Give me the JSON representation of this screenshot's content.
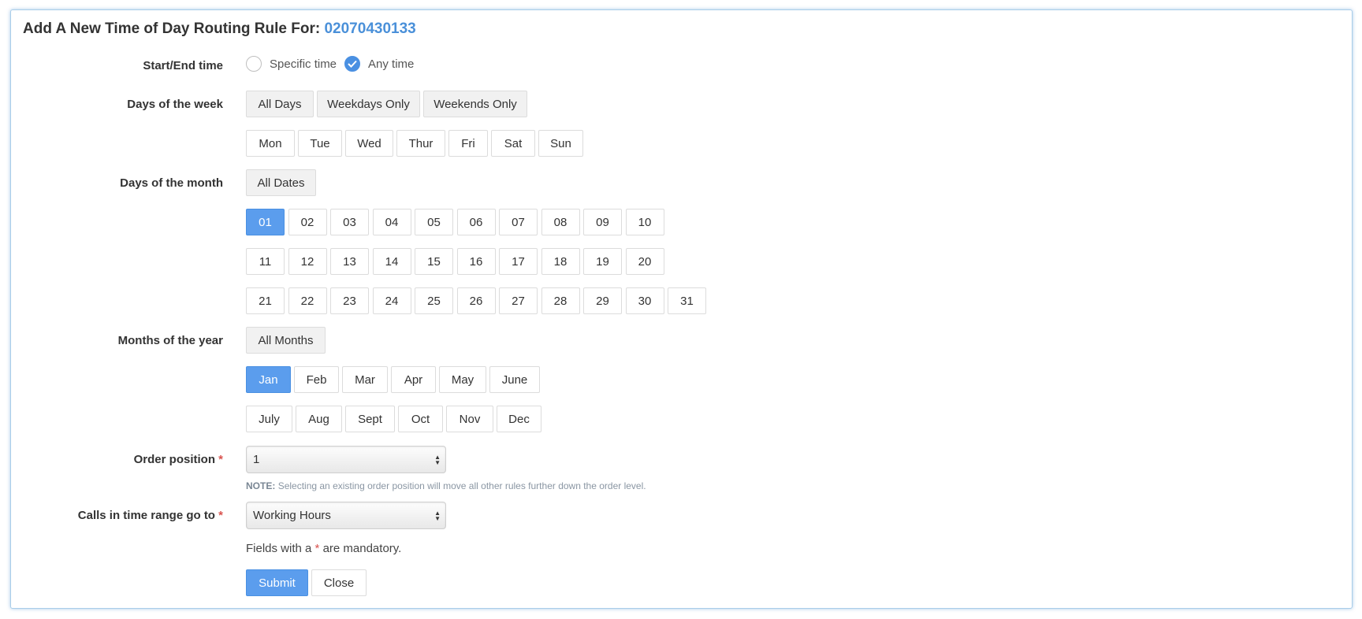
{
  "header": {
    "title_prefix": "Add A New Time of Day Routing Rule For:",
    "number": "02070430133"
  },
  "start_end": {
    "label": "Start/End time",
    "options": [
      {
        "label": "Specific time",
        "checked": false
      },
      {
        "label": "Any time",
        "checked": true
      }
    ]
  },
  "days_of_week": {
    "label": "Days of the week",
    "presets": [
      "All Days",
      "Weekdays Only",
      "Weekends Only"
    ],
    "days": [
      "Mon",
      "Tue",
      "Wed",
      "Thur",
      "Fri",
      "Sat",
      "Sun"
    ]
  },
  "days_of_month": {
    "label": "Days of the month",
    "preset": "All Dates",
    "dates": [
      "01",
      "02",
      "03",
      "04",
      "05",
      "06",
      "07",
      "08",
      "09",
      "10",
      "11",
      "12",
      "13",
      "14",
      "15",
      "16",
      "17",
      "18",
      "19",
      "20",
      "21",
      "22",
      "23",
      "24",
      "25",
      "26",
      "27",
      "28",
      "29",
      "30",
      "31"
    ],
    "selected": [
      "01"
    ]
  },
  "months": {
    "label": "Months of the year",
    "preset": "All Months",
    "items": [
      "Jan",
      "Feb",
      "Mar",
      "Apr",
      "May",
      "June",
      "July",
      "Aug",
      "Sept",
      "Oct",
      "Nov",
      "Dec"
    ],
    "selected": [
      "Jan"
    ]
  },
  "order_position": {
    "label": "Order position",
    "required_mark": "*",
    "value": "1",
    "note_label": "NOTE:",
    "note_text": "Selecting an existing order position will move all other rules further down the order level."
  },
  "calls_destination": {
    "label": "Calls in time range go to",
    "required_mark": "*",
    "value": "Working Hours"
  },
  "mandatory": {
    "prefix": "Fields with a",
    "mark": "*",
    "suffix": "are mandatory."
  },
  "actions": {
    "submit": "Submit",
    "close": "Close"
  },
  "colors": {
    "accent": "#5b9ded",
    "title_number": "#4a90d9",
    "required": "#d9534f"
  }
}
